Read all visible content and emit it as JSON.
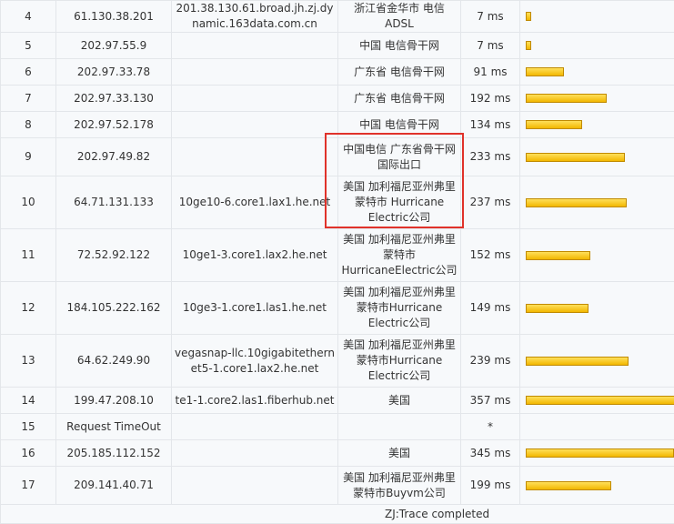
{
  "hops": [
    {
      "hop": "4",
      "ip": "61.130.38.201",
      "host": "201.38.130.61.broad.jh.zj.dynamic.163data.com.cn",
      "location": "浙江省金华市 电信ADSL",
      "time": "7 ms",
      "bar": 0.02
    },
    {
      "hop": "5",
      "ip": "202.97.55.9",
      "host": "",
      "location": "中国 电信骨干网",
      "time": "7 ms",
      "bar": 0.02
    },
    {
      "hop": "6",
      "ip": "202.97.33.78",
      "host": "",
      "location": "广东省 电信骨干网",
      "time": "91 ms",
      "bar": 0.25
    },
    {
      "hop": "7",
      "ip": "202.97.33.130",
      "host": "",
      "location": "广东省 电信骨干网",
      "time": "192 ms",
      "bar": 0.53
    },
    {
      "hop": "8",
      "ip": "202.97.52.178",
      "host": "",
      "location": "中国 电信骨干网",
      "time": "134 ms",
      "bar": 0.37
    },
    {
      "hop": "9",
      "ip": "202.97.49.82",
      "host": "",
      "location": "中国电信 广东省骨干网 国际出口",
      "time": "233 ms",
      "bar": 0.65
    },
    {
      "hop": "10",
      "ip": "64.71.131.133",
      "host": "10ge10-6.core1.lax1.he.net",
      "location": "美国 加利福尼亚州弗里蒙特市 Hurricane Electric公司",
      "time": "237 ms",
      "bar": 0.66
    },
    {
      "hop": "11",
      "ip": "72.52.92.122",
      "host": "10ge1-3.core1.lax2.he.net",
      "location": "美国 加利福尼亚州弗里蒙特市HurricaneElectric公司",
      "time": "152 ms",
      "bar": 0.42
    },
    {
      "hop": "12",
      "ip": "184.105.222.162",
      "host": "10ge3-1.core1.las1.he.net",
      "location": "美国 加利福尼亚州弗里蒙特市Hurricane Electric公司",
      "time": "149 ms",
      "bar": 0.41
    },
    {
      "hop": "13",
      "ip": "64.62.249.90",
      "host": "vegasnap-llc.10gigabitethernet5-1.core1.lax2.he.net",
      "location": "美国 加利福尼亚州弗里蒙特市Hurricane Electric公司",
      "time": "239 ms",
      "bar": 0.67
    },
    {
      "hop": "14",
      "ip": "199.47.208.10",
      "host": "te1-1.core2.las1.fiberhub.net",
      "location": "美国",
      "time": "357 ms",
      "bar": 1.0
    },
    {
      "hop": "15",
      "ip": "Request TimeOut",
      "host": "",
      "location": "",
      "time": "*",
      "bar": 0
    },
    {
      "hop": "16",
      "ip": "205.185.112.152",
      "host": "",
      "location": "美国",
      "time": "345 ms",
      "bar": 0.97
    },
    {
      "hop": "17",
      "ip": "209.141.40.71",
      "host": "",
      "location": "美国 加利福尼亚州弗里蒙特市Buyvm公司",
      "time": "199 ms",
      "bar": 0.56
    }
  ],
  "row_heights": [],
  "footer": {
    "status": "ZJ:Trace completed"
  },
  "colors": {
    "bar_fill": "#f5c400",
    "highlight": "#e0322a",
    "cell_bg": "#f7f9fb",
    "border": "#e3e6ea"
  }
}
